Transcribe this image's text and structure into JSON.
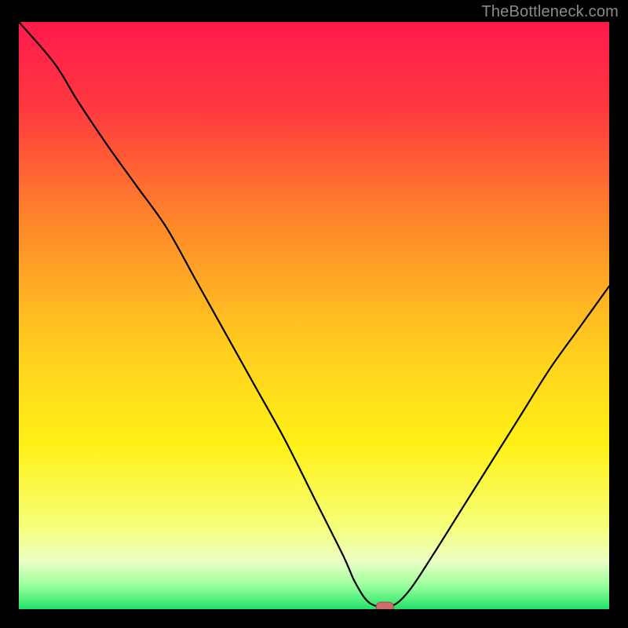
{
  "watermark": "TheBottleneck.com",
  "colors": {
    "frame": "#000000",
    "watermark": "#8b8b8b",
    "curve": "#000000",
    "marker_fill": "#d16a6a",
    "marker_stroke": "#945050",
    "gradient_stops": [
      {
        "offset": 0.0,
        "color": "#ff1a4d"
      },
      {
        "offset": 0.15,
        "color": "#ff3a3f"
      },
      {
        "offset": 0.35,
        "color": "#ff8a2a"
      },
      {
        "offset": 0.55,
        "color": "#ffcc1f"
      },
      {
        "offset": 0.72,
        "color": "#fff116"
      },
      {
        "offset": 0.86,
        "color": "#f6ff7a"
      },
      {
        "offset": 0.92,
        "color": "#e9ffc6"
      },
      {
        "offset": 0.96,
        "color": "#9aff9a"
      },
      {
        "offset": 1.0,
        "color": "#22e36b"
      }
    ]
  },
  "chart_data": {
    "type": "line",
    "title": "",
    "xlabel": "",
    "ylabel": "",
    "x": [
      0,
      6,
      10,
      15,
      20,
      25,
      30,
      35,
      40,
      45,
      50,
      55,
      57,
      59.5,
      63,
      66,
      70,
      75,
      80,
      85,
      90,
      95,
      100
    ],
    "values": [
      100,
      93,
      86.5,
      79,
      72,
      65,
      56,
      47,
      38,
      29,
      19,
      9,
      4.5,
      1,
      0.5,
      3,
      9,
      17,
      25,
      33,
      41,
      48,
      55
    ],
    "xlim": [
      0,
      100
    ],
    "ylim": [
      0,
      100
    ],
    "marker": {
      "x": 62,
      "y": 0
    }
  }
}
